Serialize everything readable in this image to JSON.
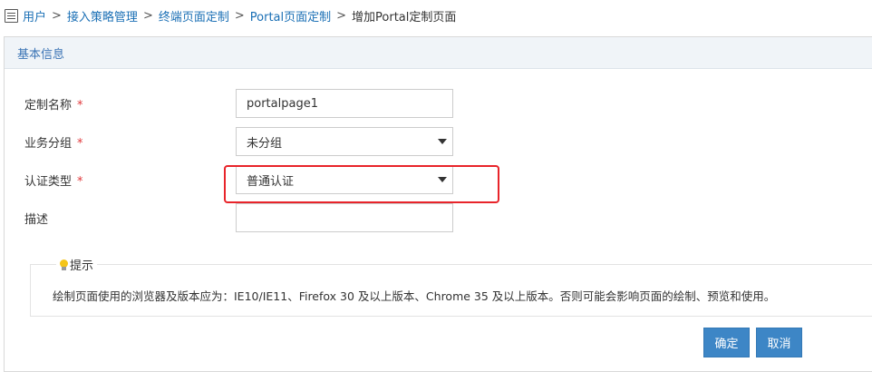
{
  "breadcrumb": {
    "items": [
      "用户",
      "接入策略管理",
      "终端页面定制",
      "Portal页面定制"
    ],
    "separator": ">",
    "current": "增加Portal定制页面"
  },
  "panel": {
    "title": "基本信息"
  },
  "form": {
    "name_label": "定制名称",
    "name_value": "portalpage1",
    "group_label": "业务分组",
    "group_value": "未分组",
    "auth_label": "认证类型",
    "auth_value": "普通认证",
    "desc_label": "描述",
    "desc_value": "",
    "required_mark": "*"
  },
  "tip": {
    "title": "提示",
    "text": "绘制页面使用的浏览器及版本应为：IE10/IE11、Firefox 30 及以上版本、Chrome 35 及以上版本。否则可能会影响页面的绘制、预览和使用。"
  },
  "buttons": {
    "ok": "确定",
    "cancel": "取消"
  },
  "colors": {
    "link": "#1a6fb5",
    "required": "#e0373a",
    "button": "#3d86c6",
    "highlight": "#e8242a"
  },
  "icons": {
    "breadcrumb": "page-icon",
    "tip": "lightbulb-icon",
    "dropdown": "caret-down-icon"
  }
}
